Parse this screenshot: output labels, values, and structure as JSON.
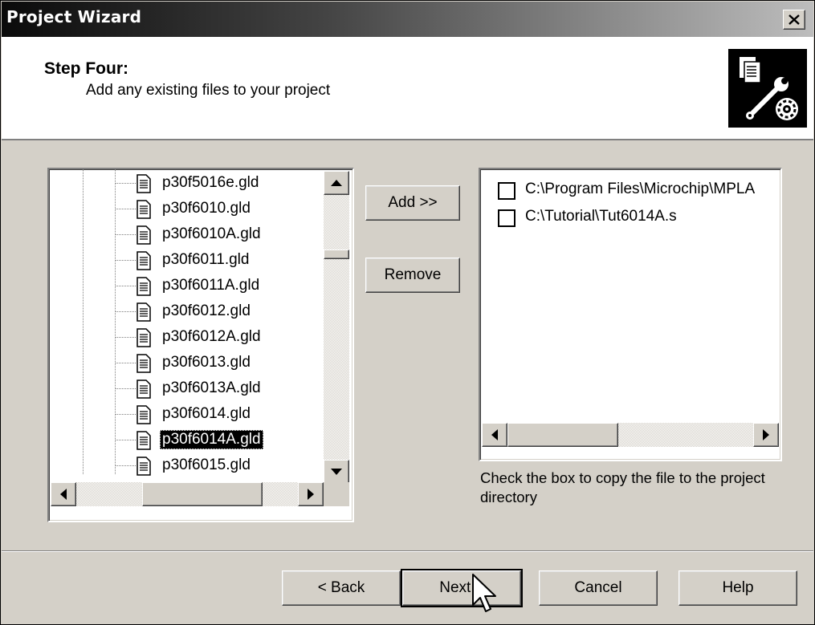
{
  "window": {
    "title": "Project Wizard",
    "close_symbol": "✕"
  },
  "header": {
    "step_title": "Step Four:",
    "step_subtitle": "Add any existing files to your project",
    "icon": "wizard-files-wrench-gear-icon"
  },
  "tree": {
    "items": [
      {
        "label": "p30f5016e.gld",
        "selected": false
      },
      {
        "label": "p30f6010.gld",
        "selected": false
      },
      {
        "label": "p30f6010A.gld",
        "selected": false
      },
      {
        "label": "p30f6011.gld",
        "selected": false
      },
      {
        "label": "p30f6011A.gld",
        "selected": false
      },
      {
        "label": "p30f6012.gld",
        "selected": false
      },
      {
        "label": "p30f6012A.gld",
        "selected": false
      },
      {
        "label": "p30f6013.gld",
        "selected": false
      },
      {
        "label": "p30f6013A.gld",
        "selected": false
      },
      {
        "label": "p30f6014.gld",
        "selected": false
      },
      {
        "label": "p30f6014A.gld",
        "selected": true
      },
      {
        "label": "p30f6015.gld",
        "selected": false
      }
    ]
  },
  "actions": {
    "add_label": "Add >>",
    "remove_label": "Remove"
  },
  "project_files": {
    "items": [
      {
        "path": "C:\\Program Files\\Microchip\\MPLA",
        "checked": false
      },
      {
        "path": "C:\\Tutorial\\Tut6014A.s",
        "checked": false
      }
    ],
    "hint": "Check the box to copy the file to the project directory"
  },
  "footer": {
    "back_label": "< Back",
    "next_label": "Next >",
    "cancel_label": "Cancel",
    "help_label": "Help"
  }
}
